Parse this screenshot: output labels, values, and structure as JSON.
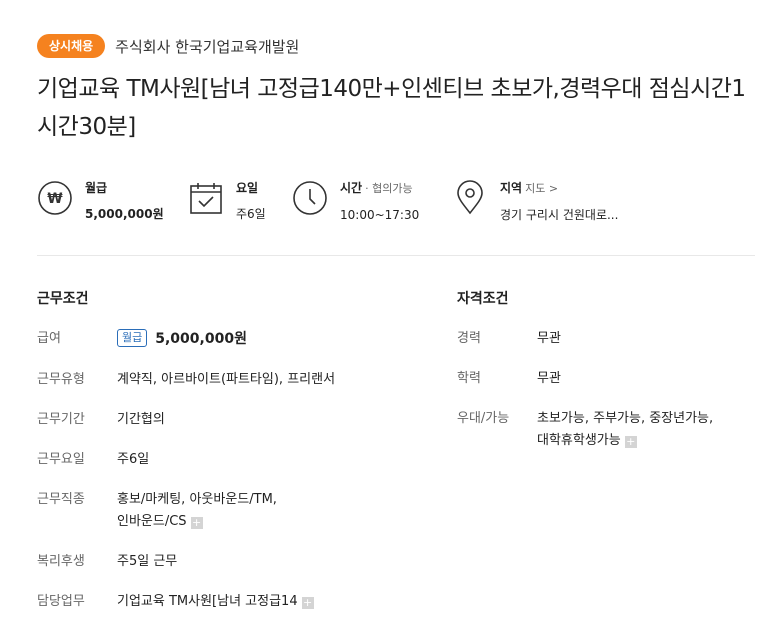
{
  "header": {
    "badge": "상시채용",
    "company": "주식회사 한국기업교육개발원",
    "title": "기업교육 TM사원[남녀 고정급140만+인센티브 초보가,경력우대 점심시간1시간30분]"
  },
  "summary": {
    "pay": {
      "label": "월급",
      "value": "5,000,000원",
      "icon": "won-icon"
    },
    "days": {
      "label": "요일",
      "value": "주6일",
      "icon": "calendar-check-icon"
    },
    "hours": {
      "label": "시간",
      "sub": "· 협의가능",
      "value": "10:00~17:30",
      "icon": "clock-icon"
    },
    "location": {
      "label": "지역",
      "sub": "지도 >",
      "value": "경기 구리시 건원대로...",
      "icon": "location-pin-icon"
    }
  },
  "conditions": {
    "title": "근무조건",
    "salary_label": "급여",
    "salary_pill": "월급",
    "salary_value": "5,000,000원",
    "rows": [
      {
        "label": "근무유형",
        "value": "계약직, 아르바이트(파트타임), 프리랜서"
      },
      {
        "label": "근무기간",
        "value": "기간협의"
      },
      {
        "label": "근무요일",
        "value": "주6일"
      },
      {
        "label": "근무직종",
        "value_line1": "홍보/마케팅, 아웃바운드/TM,",
        "value_line2": "인바운드/CS"
      },
      {
        "label": "복리후생",
        "value": "주5일 근무"
      },
      {
        "label": "담당업무",
        "value": "기업교육 TM사원[남녀 고정급14"
      }
    ],
    "more_symbol": "+"
  },
  "qualifications": {
    "title": "자격조건",
    "rows": [
      {
        "label": "경력",
        "value": "무관"
      },
      {
        "label": "학력",
        "value": "무관"
      },
      {
        "label": "우대/가능",
        "value_line1": "초보가능, 주부가능, 중장년가능,",
        "value_line2": "대학휴학생가능"
      }
    ]
  },
  "colors": {
    "badge": "#f5821f",
    "pill": "#2a6db8",
    "divider": "#e8e8e8"
  }
}
